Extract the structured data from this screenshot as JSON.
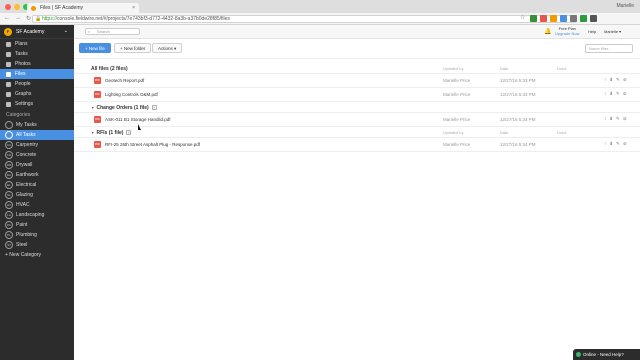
{
  "browser": {
    "tab_title": "Files | SF Academy",
    "tab_close": "×",
    "profile_name": "Marielle",
    "nav_buttons": [
      "←",
      "→",
      "↻"
    ],
    "lock": "🔒",
    "url_scheme": "https://",
    "url_rest": "console.fieldwire.net/#/projects/7e743bf3-d772-4432-8a3b-a37b0de28f85/files",
    "star": "☆"
  },
  "sidebar": {
    "project_initial": "F",
    "project_name": "SF Academy",
    "caret": "⌄",
    "items": [
      {
        "label": "Plans"
      },
      {
        "label": "Tasks"
      },
      {
        "label": "Photos"
      },
      {
        "label": "Files"
      },
      {
        "label": "People"
      },
      {
        "label": "Graphs"
      },
      {
        "label": "Settings"
      }
    ],
    "categories_label": "Categories",
    "categories": [
      {
        "badge": "",
        "label": "My Tasks"
      },
      {
        "badge": "",
        "label": "All Tasks"
      },
      {
        "badge": "CA",
        "label": "Carpentry"
      },
      {
        "badge": "CO",
        "label": "Concrete"
      },
      {
        "badge": "DR",
        "label": "Drywall"
      },
      {
        "badge": "EA",
        "label": "Earthwork"
      },
      {
        "badge": "EL",
        "label": "Electrical"
      },
      {
        "badge": "GL",
        "label": "Glazing"
      },
      {
        "badge": "HV",
        "label": "HVAC"
      },
      {
        "badge": "LA",
        "label": "Landscaping"
      },
      {
        "badge": "PA",
        "label": "Paint"
      },
      {
        "badge": "PL",
        "label": "Plumbing"
      },
      {
        "badge": "ST",
        "label": "Steel"
      }
    ],
    "new_category": "+ New Category"
  },
  "topbar": {
    "search_placeholder": "Search",
    "free_plan": "Free Plan",
    "upgrade": "Upgrade Now",
    "help": "Help",
    "user": "Marielle ▾"
  },
  "toolbar": {
    "new_file": "+ New file",
    "new_folder": "+ New folder",
    "actions": "Actions ▾",
    "filter_placeholder": "Name filter..."
  },
  "columns": {
    "updated_by": "Updated by",
    "date": "Date",
    "links": "Links"
  },
  "groups": [
    {
      "title": "All files (2 files)",
      "show_plus": false,
      "files": [
        {
          "name": "Geotech Report.pdf",
          "by": "Marielle Price",
          "date": "12/27/16 5:33 PM"
        },
        {
          "name": "Lighting Controls O&M.pdf",
          "by": "Marielle Price",
          "date": "12/27/16 5:33 PM"
        }
      ]
    },
    {
      "title": "Change Orders (1 file)",
      "show_plus": true,
      "files": [
        {
          "name": "ASK-011 B1 Storage Handlid.pdf",
          "by": "Marielle Price",
          "date": "12/27/16 5:34 PM"
        }
      ]
    },
    {
      "title": "RFIs (1 file)",
      "show_plus": true,
      "files": [
        {
          "name": "RFI-25 26th Street Asphalt Plug - Response.pdf",
          "by": "Marielle Price",
          "date": "12/27/16 5:34 PM"
        }
      ]
    }
  ],
  "file_icon_label": "PDF",
  "row_actions": [
    "↑",
    "⬇",
    "✎",
    "⊘"
  ],
  "chat": {
    "label": "Online - Need Help?"
  },
  "colors": {
    "accent": "#4a90e2",
    "sidebar_bg": "#2c2c2c",
    "pdf": "#e8574a",
    "brand": "#f2a900"
  }
}
